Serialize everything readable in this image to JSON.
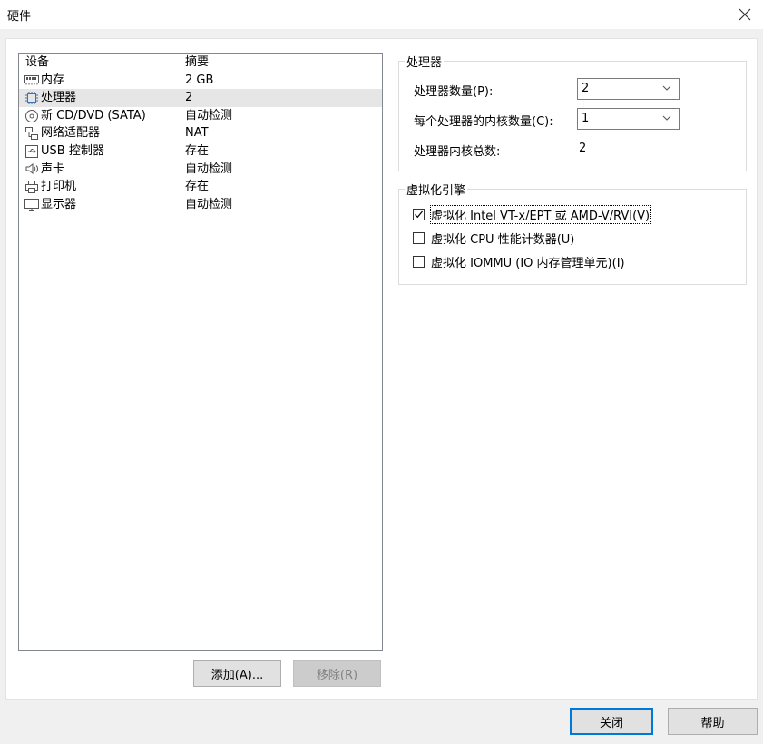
{
  "window": {
    "title": "硬件"
  },
  "device_list": {
    "headers": {
      "device": "设备",
      "summary": "摘要"
    },
    "rows": [
      {
        "name": "内存",
        "summary": "2 GB",
        "icon": "memory-icon"
      },
      {
        "name": "处理器",
        "summary": "2",
        "icon": "processor-icon"
      },
      {
        "name": "新 CD/DVD (SATA)",
        "summary": "自动检测",
        "icon": "cd-dvd-icon"
      },
      {
        "name": "网络适配器",
        "summary": "NAT",
        "icon": "network-adapter-icon"
      },
      {
        "name": "USB 控制器",
        "summary": "存在",
        "icon": "usb-icon"
      },
      {
        "name": "声卡",
        "summary": "自动检测",
        "icon": "speaker-icon"
      },
      {
        "name": "打印机",
        "summary": "存在",
        "icon": "printer-icon"
      },
      {
        "name": "显示器",
        "summary": "自动检测",
        "icon": "monitor-icon"
      }
    ]
  },
  "buttons": {
    "add": "添加(A)...",
    "remove": "移除(R)",
    "close": "关闭",
    "help": "帮助"
  },
  "processor_group": {
    "title": "处理器",
    "count_label": "处理器数量(P):",
    "count_value": "2",
    "cores_label": "每个处理器的内核数量(C):",
    "cores_value": "1",
    "total_label": "处理器内核总数:",
    "total_value": "2"
  },
  "virtualization_group": {
    "title": "虚拟化引擎",
    "options": [
      {
        "label": "虚拟化 Intel VT-x/EPT 或 AMD-V/RVI(V)",
        "checked": true
      },
      {
        "label": "虚拟化 CPU 性能计数器(U)",
        "checked": false
      },
      {
        "label": "虚拟化 IOMMU (IO 内存管理单元)(I)",
        "checked": false
      }
    ]
  }
}
